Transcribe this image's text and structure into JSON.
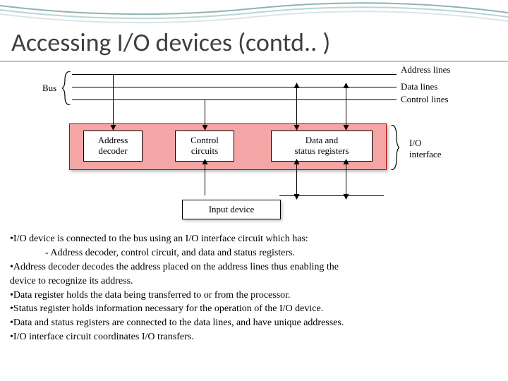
{
  "title": "Accessing I/O devices (contd.. )",
  "diagram": {
    "bus_label": "Bus",
    "lines": {
      "address": "Address lines",
      "data": "Data lines",
      "control": "Control lines"
    },
    "boxes": {
      "decoder": "Address\ndecoder",
      "control": "Control\ncircuits",
      "registers": "Data and\nstatus registers"
    },
    "io_interface": "I/O\ninterface",
    "input_device": "Input device"
  },
  "bullets": {
    "b1": "•I/O device is connected to the bus using an I/O interface circuit which has:",
    "b1sub": "- Address decoder, control circuit, and data and status registers.",
    "b2": "•Address decoder decodes the address placed on the address lines thus enabling the",
    "b2cont": " device to recognize its address.",
    "b3": "•Data register holds the data being transferred to or from the processor.",
    "b4": "•Status register holds information necessary for the operation of the I/O device.",
    "b5": "•Data and status registers are connected to the data lines, and have unique addresses.",
    "b6": "•I/O interface circuit coordinates I/O transfers."
  }
}
